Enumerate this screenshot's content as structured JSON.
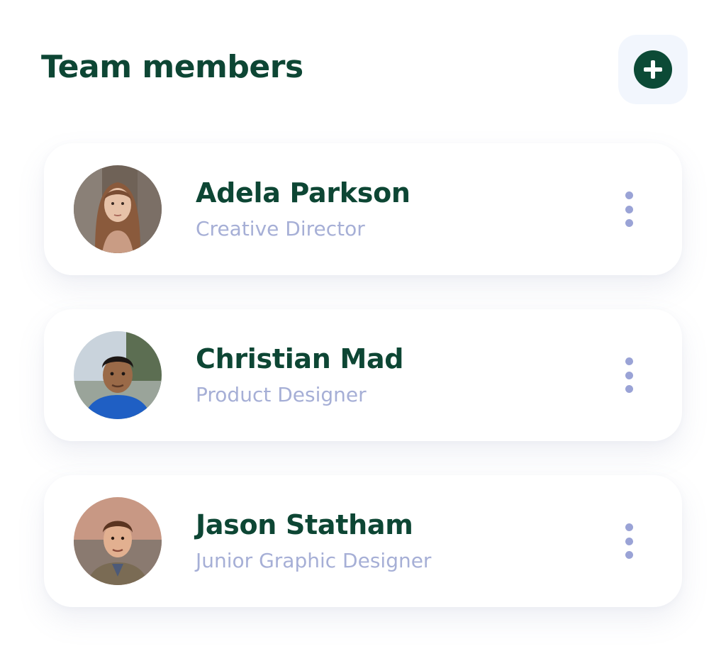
{
  "header": {
    "title": "Team members"
  },
  "colors": {
    "primary": "#0d4634",
    "secondary_text": "#a6afd6",
    "add_button_bg": "#f2f6fd",
    "dots": "#9aa3d6"
  },
  "members": [
    {
      "name": "Adela Parkson",
      "role": "Creative Director"
    },
    {
      "name": "Christian Mad",
      "role": "Product Designer"
    },
    {
      "name": "Jason Statham",
      "role": "Junior Graphic Designer"
    }
  ]
}
